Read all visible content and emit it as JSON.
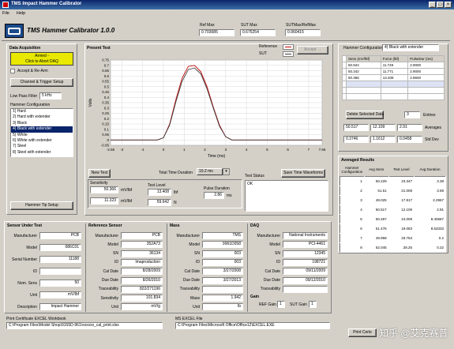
{
  "window": {
    "title": "TMS Impact Hammer Calibrator"
  },
  "menu": [
    "File",
    "Help"
  ],
  "app": {
    "title": "TMS Hammer Calibrator 1.0.0"
  },
  "header": {
    "ref_max_label": "Ref Max",
    "ref_max": "0.703085",
    "sut_max_label": "SUT Max",
    "sut_max": "0.675254",
    "ratio_label": "SUTMax/RefMax",
    "ratio": "0.960415"
  },
  "daq": {
    "title": "Data Acquisition",
    "armed_line1": "Armed -",
    "armed_line2": "Click to Abort DAQ",
    "accept_rearm": "Accept & Re-Arm",
    "channel_setup": "Channel & Trigger Setup",
    "lowpass_label": "Low Pass Filter",
    "lowpass_value": "5 kHz",
    "hammer_config_label": "Hammer Configuration",
    "hammer_configs": [
      "1) Hard",
      "2) Hard with extender",
      "3) Black",
      "4) Black with extender",
      "5) White",
      "6) White with extender",
      "7) Steel",
      "8) Steel with extender"
    ],
    "selected_index": 3,
    "tip_setup": "Hammer Tip Setup"
  },
  "present": {
    "title": "Present Test",
    "reference_label": "Reference",
    "sut_label": "SUT",
    "accept_btn": "Accept",
    "y_label": "Volts",
    "x_label": "Time (ms)",
    "new_test": "New Test",
    "duration_label": "Total Time Duration",
    "duration_value": "10.2 ms",
    "save_btn": "Save Time Waveforms",
    "test_status_label": "Test Status",
    "test_status_value": "OK"
  },
  "chart_data": {
    "type": "line",
    "x_ticks": [
      "-2.55",
      "-2",
      "-1",
      "0",
      "1",
      "2",
      "3",
      "4",
      "5",
      "6",
      "7",
      "7.65"
    ],
    "y_ticks": [
      "0.75",
      "0.7",
      "0.65",
      "0.6",
      "0.55",
      "0.5",
      "0.45",
      "0.4",
      "0.35",
      "0.3",
      "0.25",
      "0.2",
      "0.15",
      "0.1",
      "0.05",
      "0",
      "-0.05"
    ],
    "xlim": [
      -2.55,
      7.65
    ],
    "ylim": [
      -0.05,
      0.75
    ],
    "series": [
      {
        "name": "Reference",
        "color": "#c00000",
        "x": [
          -2.55,
          -0.3,
          0.0,
          0.3,
          0.6,
          0.9,
          1.2,
          1.5,
          1.8,
          2.1,
          2.4,
          2.7,
          3.0,
          3.3,
          7.65
        ],
        "y": [
          0,
          0,
          0.02,
          0.15,
          0.38,
          0.58,
          0.69,
          0.7,
          0.64,
          0.5,
          0.31,
          0.14,
          0.03,
          0,
          0
        ]
      },
      {
        "name": "SUT",
        "color": "#404040",
        "x": [
          -2.55,
          -0.3,
          0.0,
          0.3,
          0.6,
          0.9,
          1.2,
          1.5,
          1.8,
          2.1,
          2.4,
          2.7,
          3.0,
          3.3,
          7.65
        ],
        "y": [
          0,
          0,
          0.02,
          0.14,
          0.36,
          0.55,
          0.66,
          0.675,
          0.62,
          0.48,
          0.3,
          0.13,
          0.03,
          0,
          0
        ]
      }
    ]
  },
  "levels": {
    "sens_label": "Sensitivity",
    "sens_ref": "50.366",
    "sens_ref_unit": "mV/lbf",
    "sens_sut": "11.323",
    "sens_sut_unit": "mV/lbf",
    "test_level_label": "Test Level",
    "level_ref": "13.408",
    "level_ref_unit": "lbf",
    "level_sut": "59.642",
    "level_sut_unit": "N",
    "pulse_label": "Pulse Duration",
    "pulse_value": "2.86",
    "pulse_unit": "ms"
  },
  "hammer_config_panel": {
    "label": "Hammer Configuration",
    "value": "4) Black with extender",
    "headers": [
      "Sens (mV/lbf)",
      "Force (lbf)",
      "PulseDur (ms)"
    ],
    "rows": [
      [
        "50.944",
        "11.749",
        "2.9000"
      ],
      [
        "50.342",
        "11.771",
        "2.9000"
      ],
      [
        "50.366",
        "13.408",
        "2.8600"
      ],
      [
        "",
        "",
        ""
      ],
      [
        "",
        "",
        ""
      ],
      [
        "",
        "",
        ""
      ]
    ],
    "delete_btn": "Delete Selected Data",
    "entries_value": "3",
    "entries_label": "Entries",
    "averages": [
      "50.517",
      "12.109",
      "2.91"
    ],
    "averages_label": "Averages",
    "stddevs": [
      "0.3746",
      "1.1612",
      "0.0458"
    ],
    "stddev_label": "Std Dev"
  },
  "averaged_results": {
    "title": "Averaged Results",
    "headers": [
      "Hammer Configuration",
      "Avg Sens",
      "Test Level",
      "Avg Duration"
    ],
    "rows": [
      [
        "1",
        "50.229",
        "23.347",
        "3.38"
      ],
      [
        "2",
        "51.51",
        "21.008",
        "3.59"
      ],
      [
        "3",
        "49.025",
        "17.917",
        "2.2967"
      ],
      [
        "4",
        "50.517",
        "12.109",
        "2.91"
      ],
      [
        "5",
        "50.267",
        "24.009",
        "8.40667"
      ],
      [
        "6",
        "51.476",
        "19.083",
        "8.63333"
      ],
      [
        "7",
        "49.958",
        "33.753",
        "0.2"
      ],
      [
        "8",
        "52.045",
        "28.25",
        "0.22"
      ]
    ]
  },
  "sut": {
    "title": "Sensor Under Test",
    "fields": [
      {
        "label": "Manufacturer",
        "value": "PCB"
      },
      {
        "label": "Model",
        "value": "086C01"
      },
      {
        "label": "Serial Number",
        "value": "11188"
      },
      {
        "label": "ID",
        "value": ""
      },
      {
        "label": "Nom. Sens",
        "value": "50"
      },
      {
        "label": "Unit",
        "value": "mV/lbf"
      },
      {
        "label": "Description",
        "value": "Impact Hammer"
      }
    ]
  },
  "ref": {
    "title": "Reference Sensor",
    "fields": [
      {
        "label": "Manufacturer",
        "value": "PCB"
      },
      {
        "label": "Model",
        "value": "352A73"
      },
      {
        "label": "SN",
        "value": "36134"
      },
      {
        "label": "ID",
        "value": "Imaproduction"
      },
      {
        "label": "Cal Date",
        "value": "8/28/2009"
      },
      {
        "label": "Due Date",
        "value": "8/26/2010"
      },
      {
        "label": "Traceability",
        "value": "822/271196"
      },
      {
        "label": "Sensitivity",
        "value": "101.834"
      },
      {
        "label": "Unit",
        "value": "mV/g"
      }
    ]
  },
  "mass": {
    "title": "Mass",
    "fields": [
      {
        "label": "Manufacturer",
        "value": "TMS"
      },
      {
        "label": "Model",
        "value": "9961D058"
      },
      {
        "label": "SN",
        "value": "003"
      },
      {
        "label": "ID",
        "value": "003"
      },
      {
        "label": "Cal Date",
        "value": "3/27/2008"
      },
      {
        "label": "Due Date",
        "value": "3/27/2013"
      },
      {
        "label": "Traceability",
        "value": ""
      },
      {
        "label": "Mass",
        "value": "1.942"
      },
      {
        "label": "Unit",
        "value": "lb"
      }
    ]
  },
  "daq_info": {
    "title": "DAQ",
    "fields": [
      {
        "label": "Manufacturer",
        "value": "National Instruments"
      },
      {
        "label": "Model",
        "value": "PCI-4461"
      },
      {
        "label": "SN",
        "value": "12345"
      },
      {
        "label": "ID",
        "value": "198721"
      },
      {
        "label": "Cal Date",
        "value": "09/11/2009"
      },
      {
        "label": "Due Date",
        "value": "09/12/2010"
      },
      {
        "label": "Traceability",
        "value": ""
      }
    ],
    "gain_title": "Gain",
    "ref_gain_label": "REF Gain",
    "ref_gain": "1",
    "sut_gain_label": "SUT Gain",
    "sut_gain": "1"
  },
  "files": {
    "print_label": "Print Certificate EXCEL Workbook",
    "print_path": "C:\\Program Files\\Model Shop\\9155D-961\\xxxxxx_cal_print.xlsx",
    "excel_label": "MS EXCEL File",
    "excel_path": "C:\\Program Files\\Microsoft Office\\Office12\\EXCEL.EXE",
    "print_btn": "Print Certs"
  },
  "watermark": "知乎 @艾克赛普"
}
